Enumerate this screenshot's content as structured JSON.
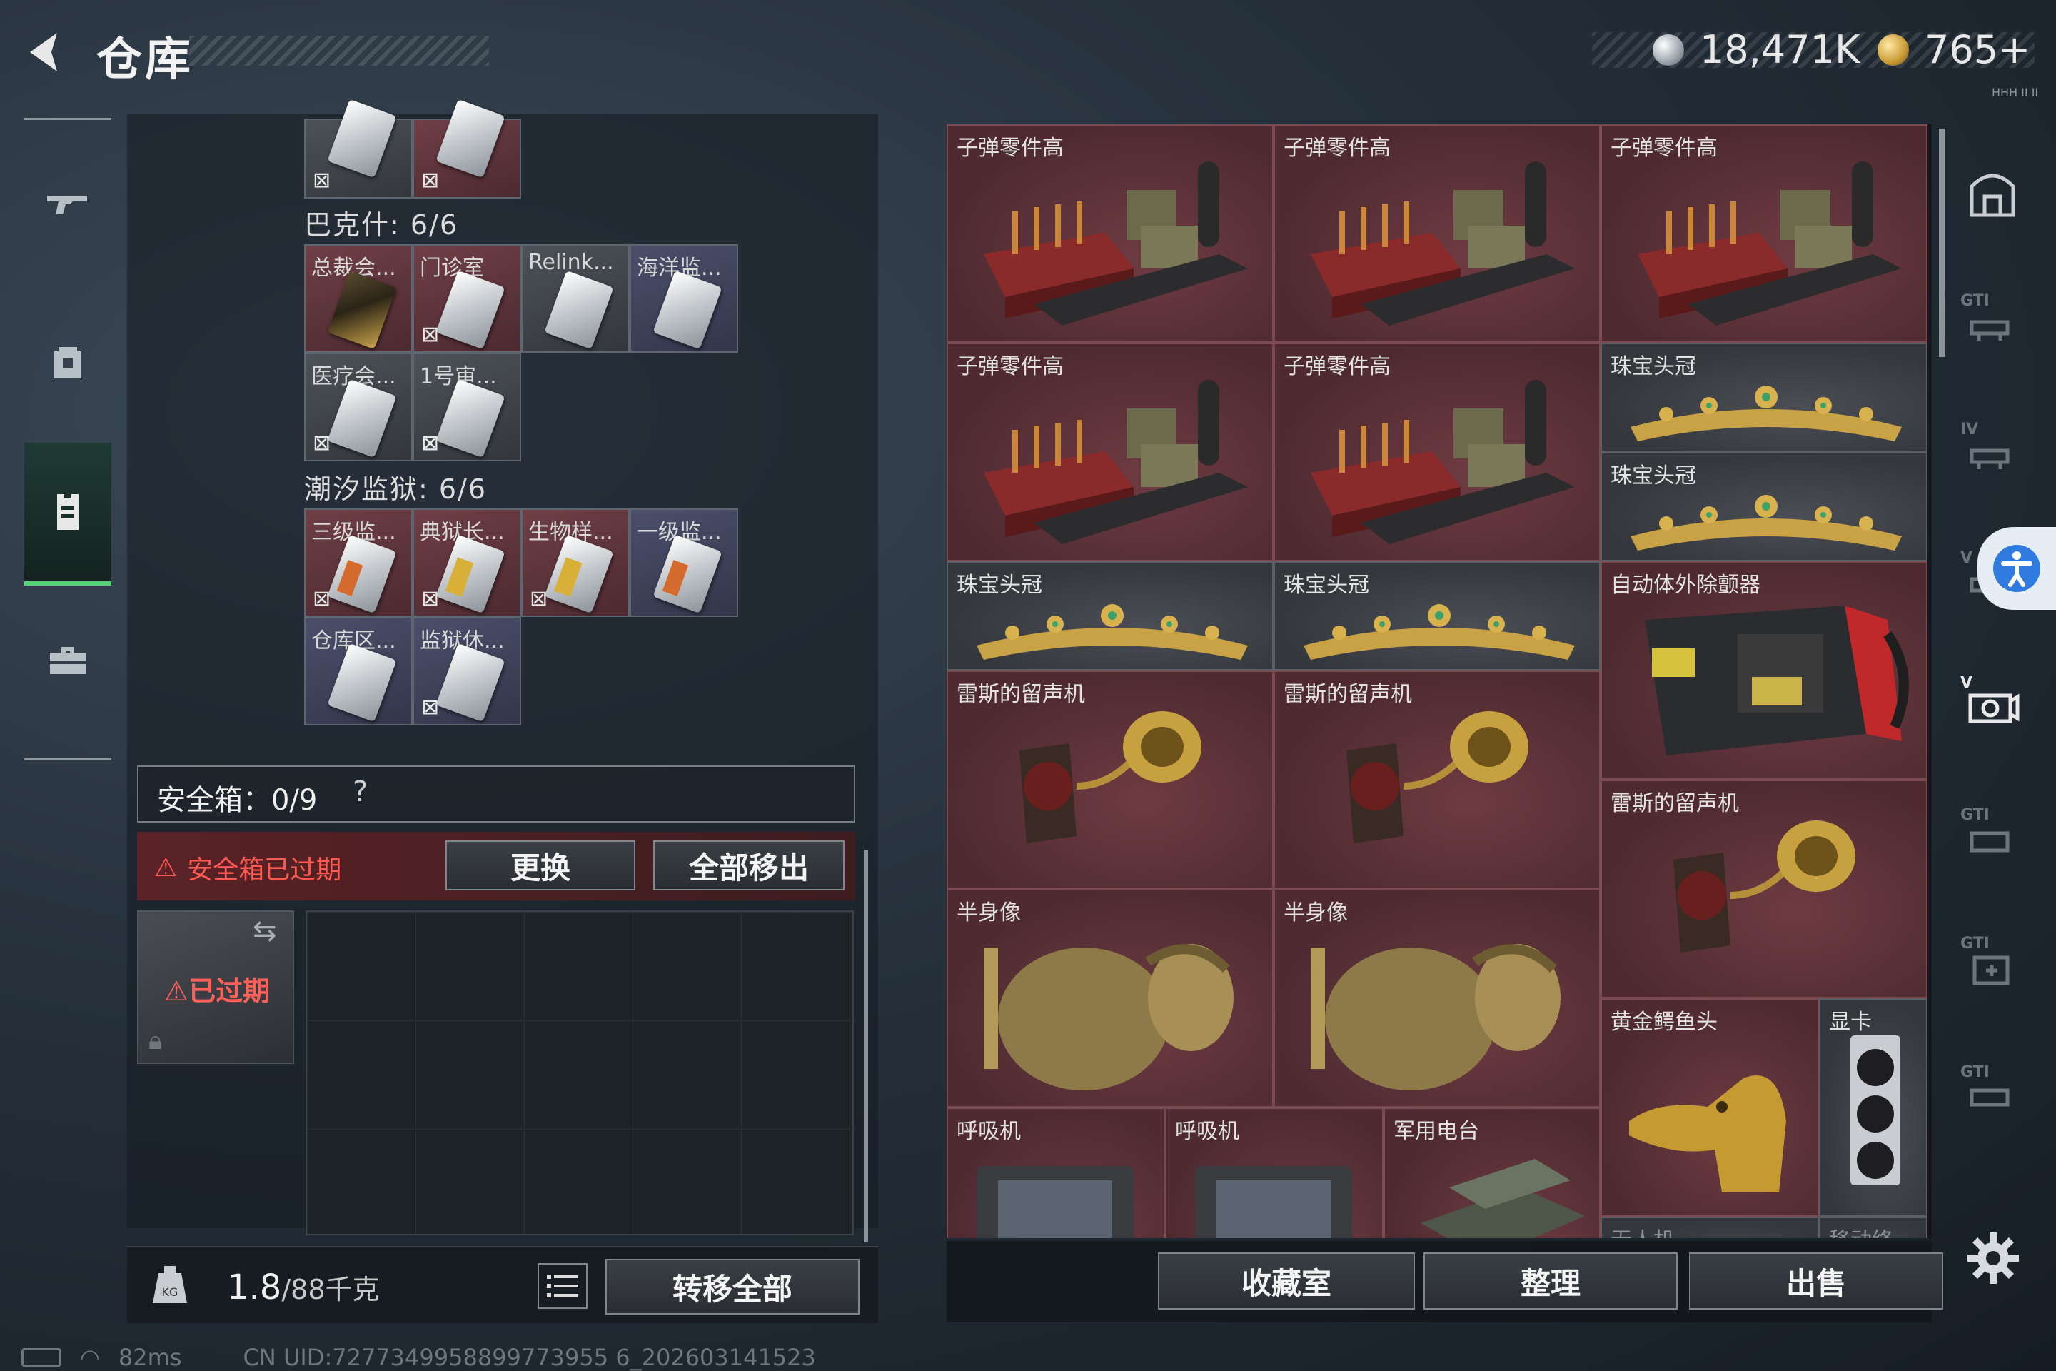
{
  "header": {
    "title": "仓库",
    "currency_1": "18,471K",
    "currency_2": "765+",
    "version_mark": "HHH II II"
  },
  "left_nav": {
    "items": [
      {
        "icon": "gun-icon"
      },
      {
        "icon": "backpack-icon"
      },
      {
        "icon": "vest-icon",
        "active": true
      },
      {
        "icon": "toolbox-icon"
      }
    ]
  },
  "keys": {
    "top_row": [
      "",
      ""
    ],
    "groups": [
      {
        "label": "巴克什: 6/6",
        "items": [
          "总裁会...",
          "门诊室",
          "Relink...",
          "海洋监...",
          "医疗会...",
          "1号审..."
        ]
      },
      {
        "label": "潮汐监狱: 6/6",
        "items": [
          "三级监...",
          "典狱长...",
          "生物样...",
          "一级监...",
          "仓库区...",
          "监狱休..."
        ]
      }
    ]
  },
  "safebox": {
    "title": "安全箱：0/9",
    "help": "?",
    "expired_notice": "安全箱已过期",
    "replace_button": "更换",
    "remove_all_button": "全部移出",
    "expired_badge": "已过期"
  },
  "footer_left": {
    "weight_value": "1.8",
    "weight_unit": "/88千克",
    "transfer_all_button": "转移全部"
  },
  "status_bar": {
    "ping": "82ms",
    "uid": "CN UID:7277349958899773955 6_202603141523"
  },
  "inventory": {
    "items": [
      {
        "label": "子弹零件高",
        "kind": "ammo"
      },
      {
        "label": "子弹零件高",
        "kind": "ammo"
      },
      {
        "label": "子弹零件高",
        "kind": "ammo"
      },
      {
        "label": "子弹零件高",
        "kind": "ammo"
      },
      {
        "label": "子弹零件高",
        "kind": "ammo"
      },
      {
        "label": "珠宝头冠",
        "kind": "tiara"
      },
      {
        "label": "珠宝头冠",
        "kind": "tiara"
      },
      {
        "label": "珠宝头冠",
        "kind": "tiara"
      },
      {
        "label": "珠宝头冠",
        "kind": "tiara"
      },
      {
        "label": "自动体外除颤器",
        "kind": "aed"
      },
      {
        "label": "雷斯的留声机",
        "kind": "gramophone"
      },
      {
        "label": "雷斯的留声机",
        "kind": "gramophone"
      },
      {
        "label": "雷斯的留声机",
        "kind": "gramophone"
      },
      {
        "label": "半身像",
        "kind": "bust"
      },
      {
        "label": "半身像",
        "kind": "bust"
      },
      {
        "label": "黄金鳄鱼头",
        "kind": "croc"
      },
      {
        "label": "显卡",
        "kind": "gpu"
      },
      {
        "label": "呼吸机",
        "kind": "ventilator"
      },
      {
        "label": "呼吸机",
        "kind": "ventilator"
      },
      {
        "label": "军用电台",
        "kind": "radio"
      },
      {
        "label": "无人机",
        "kind": "drone"
      },
      {
        "label": "移动终...",
        "kind": "terminal"
      }
    ]
  },
  "footer_right": {
    "collection_button": "收藏室",
    "organize_button": "整理",
    "sell_button": "出售"
  },
  "right_rail": {
    "items": [
      {
        "icon": "safe-room-icon",
        "tier": ""
      },
      {
        "icon": "gti-category-icon",
        "tier": "GTI"
      },
      {
        "icon": "tier-iv-icon",
        "tier": "IV"
      },
      {
        "icon": "tier-v-icon",
        "tier": "V"
      },
      {
        "icon": "camera-category-icon",
        "tier": "V"
      },
      {
        "icon": "gti-tool-icon",
        "tier": "GTI"
      },
      {
        "icon": "gti-medical-icon",
        "tier": "GTI"
      },
      {
        "icon": "gti-device-icon",
        "tier": "GTI"
      }
    ]
  },
  "colors": {
    "accent_green": "#58d07a",
    "danger_red": "#ff5a52",
    "cell_red": "#5e343a"
  }
}
